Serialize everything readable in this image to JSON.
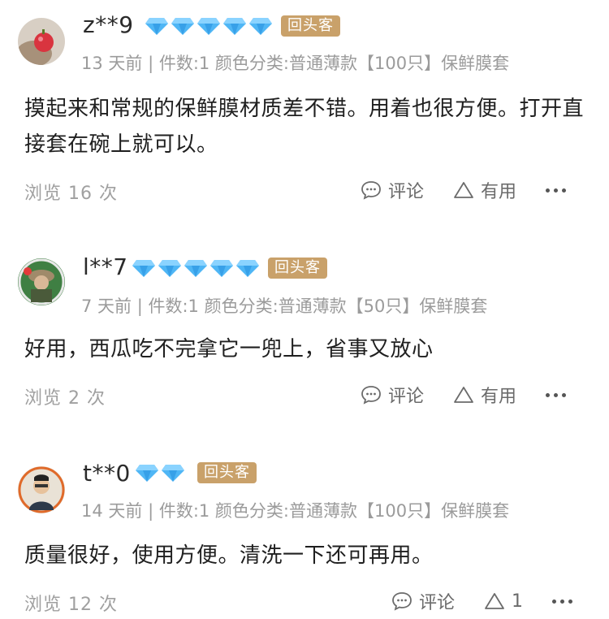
{
  "reviews": [
    {
      "username": "z**9",
      "badge": "回头客",
      "diamonds": 5,
      "meta": "13 天前 | 件数:1 颜色分类:普通薄款【100只】保鲜膜套",
      "content": "摸起来和常规的保鲜膜材质差不错。用着也很方便。打开直接套在碗上就可以。",
      "views": "浏览 16 次",
      "comment_label": "评论",
      "useful_label": "有用"
    },
    {
      "username": "l**7",
      "badge": "回头客",
      "diamonds": 5,
      "meta": "7 天前 | 件数:1 颜色分类:普通薄款【50只】保鲜膜套",
      "content": "好用，西瓜吃不完拿它一兜上，省事又放心",
      "views": "浏览 2 次",
      "comment_label": "评论",
      "useful_label": "有用"
    },
    {
      "username": "t**0",
      "badge": "回头客",
      "diamonds": 2,
      "meta": "14 天前 | 件数:1 颜色分类:普通薄款【100只】保鲜膜套",
      "content": "质量很好，使用方便。清洗一下还可再用。",
      "views": "浏览 12 次",
      "comment_label": "评论",
      "useful_label": "1"
    }
  ],
  "colors": {
    "diamond": "#4fb6f5",
    "badge_bg": "#c9a16a",
    "meta_text": "#9b9b9b"
  },
  "icons": {
    "diamond": "diamond-icon",
    "comment": "chat-bubble-icon",
    "useful": "triangle-up-icon",
    "more": "more-dots-icon"
  }
}
